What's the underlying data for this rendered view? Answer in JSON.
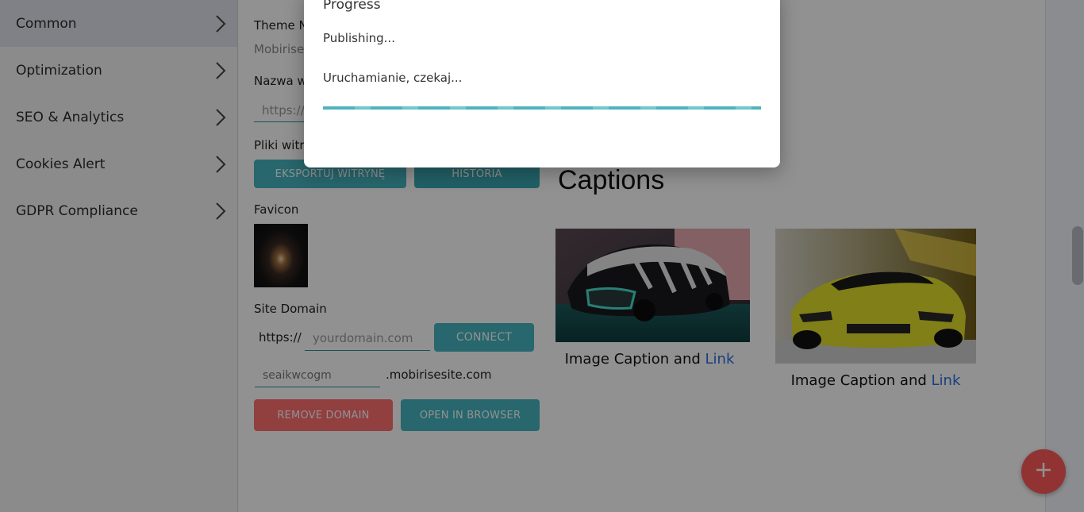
{
  "nav": {
    "items": [
      {
        "label": "Common",
        "active": true
      },
      {
        "label": "Optimization"
      },
      {
        "label": "SEO & Analytics"
      },
      {
        "label": "Cookies Alert"
      },
      {
        "label": "GDPR Compliance"
      }
    ]
  },
  "panel": {
    "theme_label": "Theme N",
    "theme_value": "Mobirise",
    "site_name_label": "Nazwa w",
    "site_url_placeholder": "https://",
    "site_files_label": "Pliki witry",
    "export_button": "EKSPORTUJ WITRYNĘ",
    "history_button": "HISTORIA",
    "favicon_label": "Favicon",
    "site_domain_label": "Site Domain",
    "domain_prefix": "https://",
    "domain_placeholder": "yourdomain.com",
    "connect_button": "CONNECT",
    "subdomain_value": "seaikwcogm",
    "subdomain_suffix": ".mobirisesite.com",
    "remove_domain_button": "REMOVE DOMAIN",
    "open_browser_button": "OPEN IN BROWSER"
  },
  "preview": {
    "heading": "Captions",
    "cards": [
      {
        "caption": "Image Caption and",
        "link": "Link",
        "image": "futuristic-concept-car"
      },
      {
        "caption": "Image Caption and",
        "link": "Link",
        "image": "yellow-sports-car"
      }
    ]
  },
  "modal": {
    "title": "Progress",
    "status": "Publishing...",
    "message": "Uruchamianie, czekaj...",
    "progress": 1.0
  },
  "colors": {
    "accent_teal": "#45b6c0",
    "danger_red": "#ff6f6f",
    "fab_red": "#ff5a5a",
    "link_blue": "#2f6fe0"
  },
  "icons": {
    "nav_chevron": "chevron-right-icon",
    "fab": "plus-icon"
  }
}
